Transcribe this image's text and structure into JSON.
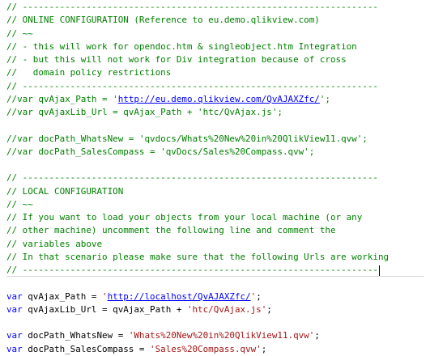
{
  "editor": {
    "lines": [
      {
        "segments": [
          {
            "t": "comment",
            "text": "// -------------------------------------------------------------------"
          }
        ]
      },
      {
        "segments": [
          {
            "t": "comment",
            "text": "// ONLINE CONFIGURATION (Reference to eu.demo.qlikview.com)"
          }
        ]
      },
      {
        "segments": [
          {
            "t": "comment",
            "text": "// ~~"
          }
        ]
      },
      {
        "segments": [
          {
            "t": "comment",
            "text": "// - this will work for opendoc.htm & singleobject.htm Integration"
          }
        ]
      },
      {
        "segments": [
          {
            "t": "comment",
            "text": "// - but this will not work for Div integration because of cross"
          }
        ]
      },
      {
        "segments": [
          {
            "t": "comment",
            "text": "//   domain policy restrictions"
          }
        ]
      },
      {
        "segments": [
          {
            "t": "comment",
            "text": "// -------------------------------------------------------------------"
          }
        ]
      },
      {
        "segments": [
          {
            "t": "comment",
            "text": "//var qvAjax_Path = '"
          },
          {
            "t": "link",
            "text": "http://eu.demo.qlikview.com/QvAJAXZfc/"
          },
          {
            "t": "comment",
            "text": "';"
          }
        ]
      },
      {
        "segments": [
          {
            "t": "comment",
            "text": "//var qvAjaxLib_Url = qvAjax_Path + 'htc/QvAjax.js';"
          }
        ]
      },
      {
        "segments": [
          {
            "t": "plain",
            "text": ""
          }
        ]
      },
      {
        "segments": [
          {
            "t": "comment",
            "text": "//var docPath_WhatsNew = 'qvdocs/Whats%20New%20in%20QlikView11.qvw';"
          }
        ]
      },
      {
        "segments": [
          {
            "t": "comment",
            "text": "//var docPath_SalesCompass = 'qvDocs/Sales%20Compass.qvw';"
          }
        ]
      },
      {
        "segments": [
          {
            "t": "plain",
            "text": ""
          }
        ]
      },
      {
        "segments": [
          {
            "t": "comment",
            "text": "// -------------------------------------------------------------------"
          }
        ]
      },
      {
        "segments": [
          {
            "t": "comment",
            "text": "// LOCAL CONFIGURATION"
          }
        ]
      },
      {
        "segments": [
          {
            "t": "comment",
            "text": "// ~~"
          }
        ]
      },
      {
        "segments": [
          {
            "t": "comment",
            "text": "// If you want to load your objects from your local machine (or any"
          }
        ]
      },
      {
        "segments": [
          {
            "t": "comment",
            "text": "// other machine) uncomment the following line and comment the"
          }
        ]
      },
      {
        "segments": [
          {
            "t": "comment",
            "text": "// variables above"
          }
        ]
      },
      {
        "segments": [
          {
            "t": "comment",
            "text": "// In that scenario please make sure that the following Urls are working"
          }
        ]
      },
      {
        "caret": true,
        "segments": [
          {
            "t": "comment",
            "text": "// -------------------------------------------------------------------"
          }
        ]
      },
      {
        "segments": [
          {
            "t": "plain",
            "text": ""
          }
        ]
      },
      {
        "segments": [
          {
            "t": "kw",
            "text": "var"
          },
          {
            "t": "plain",
            "text": " qvAjax_Path = "
          },
          {
            "t": "str",
            "text": "'"
          },
          {
            "t": "link",
            "text": "http://localhost/QvAJAXZfc/"
          },
          {
            "t": "str",
            "text": "'"
          },
          {
            "t": "plain",
            "text": ";"
          }
        ]
      },
      {
        "segments": [
          {
            "t": "kw",
            "text": "var"
          },
          {
            "t": "plain",
            "text": " qvAjaxLib_Url = qvAjax_Path + "
          },
          {
            "t": "str",
            "text": "'htc/QvAjax.js'"
          },
          {
            "t": "plain",
            "text": ";"
          }
        ]
      },
      {
        "segments": [
          {
            "t": "plain",
            "text": ""
          }
        ]
      },
      {
        "segments": [
          {
            "t": "kw",
            "text": "var"
          },
          {
            "t": "plain",
            "text": " docPath_WhatsNew = "
          },
          {
            "t": "str",
            "text": "'Whats%20New%20in%20QlikView11.qvw'"
          },
          {
            "t": "plain",
            "text": ";"
          }
        ]
      },
      {
        "segments": [
          {
            "t": "kw",
            "text": "var"
          },
          {
            "t": "plain",
            "text": " docPath_SalesCompass = "
          },
          {
            "t": "str",
            "text": "'Sales%20Compass.qvw'"
          },
          {
            "t": "plain",
            "text": ";"
          }
        ]
      }
    ]
  }
}
